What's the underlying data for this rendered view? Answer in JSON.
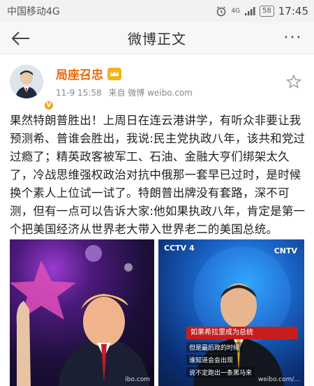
{
  "status_bar": {
    "carrier": "中国移动4G",
    "battery": "58",
    "time": "17:45",
    "signal": "4G"
  },
  "nav": {
    "title": "微博正文",
    "more_label": "···",
    "back_icon": "arrow-left-icon"
  },
  "post": {
    "author": "局座召忠",
    "date": "11-9 15:58",
    "source": "来自 微博 weibo.com",
    "text": "果然特朗普胜出！上周日在连云港讲学，有听众非要让我预测希、普谁会胜出，我说:民主党执政八年，该共和党过过瘾了；精英政客被军工、石油、金融大亨们绑架太久了，冷战思维强权政治对抗中俄那一套早已过时，是时候换个素人上位试一试了。特朗普出牌没有套路，深不可测，但有一点可以告诉大家:他如果执政八年，肯定是第一个把美国经济从世界老大带入世界老二的美国总统。Yes,he can!",
    "images": [
      {
        "watermark": "ibo.com"
      },
      {
        "logo_left": "CCTV 4",
        "logo_right": "CNTV",
        "lower_third": "如果希拉里成为总统",
        "subtitle1": "但是最后政的时候",
        "subtitle2": "谁知道会会出现",
        "subtitle3": "说不定跑出一条黑马来",
        "watermark": "weibo.com/..."
      }
    ]
  },
  "colors": {
    "author": "#e86b0c",
    "vip_badge": "#f5b21c",
    "verified_badge": "#f5a623"
  }
}
